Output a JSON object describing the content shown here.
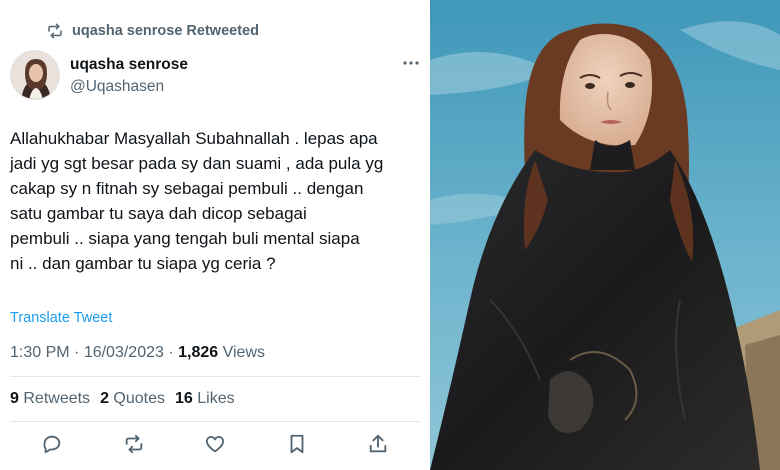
{
  "retweet_banner": {
    "text": "uqasha senrose Retweeted",
    "icon": "retweet-icon"
  },
  "author": {
    "display_name": "uqasha senrose",
    "handle": "@Uqashasen",
    "avatar_icon": "avatar"
  },
  "tweet": {
    "text": "Allahukhabar Masyallah Subahnallah . lepas apa\njadi yg sgt besar pada sy dan suami , ada pula yg\ncakap sy n fitnah sy sebagai pembuli .. dengan\nsatu gambar tu saya dah dicop sebagai\npembuli .. siapa yang tengah buli mental siapa\nni .. dan gambar tu siapa yg ceria ?",
    "translate_label": "Translate Tweet",
    "time": "1:30 PM",
    "date": "16/03/2023",
    "view_count": "1,826",
    "views_label": "Views"
  },
  "stats": {
    "retweets_count": "9",
    "retweets_label": "Retweets",
    "quotes_count": "2",
    "quotes_label": "Quotes",
    "likes_count": "16",
    "likes_label": "Likes"
  },
  "actions": [
    "reply-icon",
    "retweet-icon",
    "like-icon",
    "bookmark-icon",
    "share-icon"
  ],
  "colors": {
    "link": "#1d9bf0",
    "secondary_text": "#536471",
    "primary_text": "#0f1419"
  }
}
